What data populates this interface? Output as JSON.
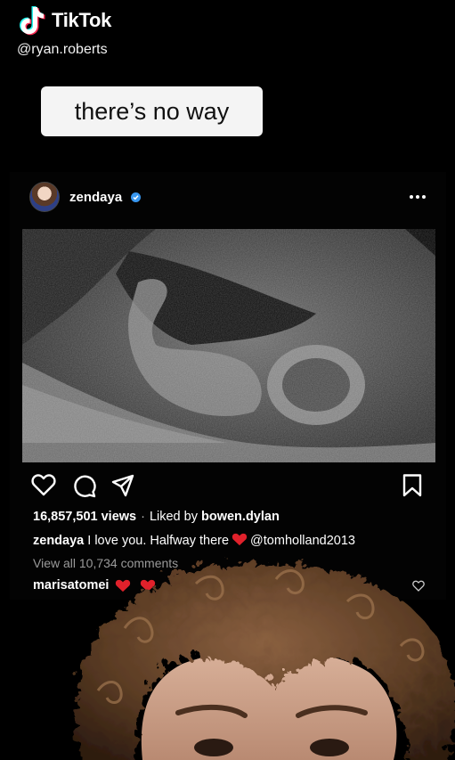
{
  "tiktok": {
    "brand": "TikTok",
    "handle": "@ryan.roberts"
  },
  "caption": "there’s no way",
  "post": {
    "username": "zendaya",
    "views": "16,857,501 views",
    "separator": "·",
    "liked_by_prefix": "Liked by",
    "liked_by_user": "bowen.dylan",
    "caption_user": "zendaya",
    "caption_text": "I love you. Halfway there",
    "mention": "@tomholland2013",
    "view_comments": "View all 10,734 comments",
    "comment_user": "marisatomei"
  },
  "colors": {
    "background": "#000000",
    "caption_box": "#f4f4f4",
    "verified": "#3897f0",
    "heart_emoji": "#e0212b"
  },
  "icons": {
    "brand": "tiktok-logo-icon",
    "verified": "verified-badge-icon",
    "more": "more-options-icon",
    "like": "heart-icon",
    "comment": "comment-icon",
    "share": "share-icon",
    "save": "bookmark-icon",
    "comment_like": "small-heart-icon"
  }
}
